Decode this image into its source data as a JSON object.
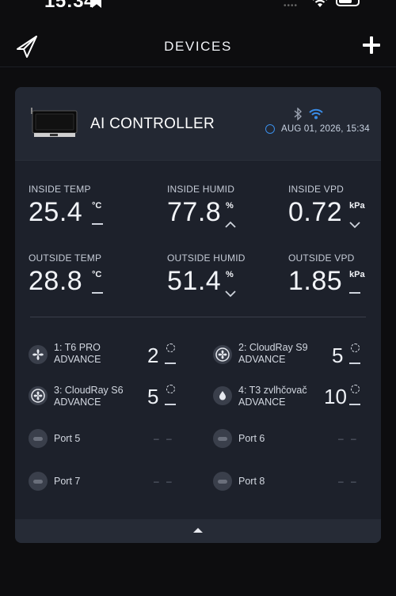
{
  "status_bar": {
    "time": "15:34"
  },
  "header": {
    "title": "DEVICES"
  },
  "device": {
    "name": "AI CONTROLLER",
    "timestamp": "AUG 01, 2026, 15:34"
  },
  "metrics": {
    "inside_temp": {
      "label": "INSIDE TEMP",
      "value": "25.4",
      "unit": "°C",
      "trend": "flat"
    },
    "inside_humid": {
      "label": "INSIDE HUMID",
      "value": "77.8",
      "unit": "%",
      "trend": "up"
    },
    "inside_vpd": {
      "label": "INSIDE VPD",
      "value": "0.72",
      "unit": "kPa",
      "trend": "down"
    },
    "outside_temp": {
      "label": "OUTSIDE TEMP",
      "value": "28.8",
      "unit": "°C",
      "trend": "flat"
    },
    "outside_humid": {
      "label": "OUTSIDE HUMID",
      "value": "51.4",
      "unit": "%",
      "trend": "down"
    },
    "outside_vpd": {
      "label": "OUTSIDE VPD",
      "value": "1.85",
      "unit": "kPa",
      "trend": "flat"
    }
  },
  "ports": [
    {
      "line1": "1: T6 PRO",
      "line2": "ADVANCE",
      "level": "2",
      "icon": "fan-icon"
    },
    {
      "line1": "2: CloudRay S9",
      "line2": "ADVANCE",
      "level": "5",
      "icon": "fan-icon"
    },
    {
      "line1": "3: CloudRay S6",
      "line2": "ADVANCE",
      "level": "5",
      "icon": "fan-icon"
    },
    {
      "line1": "4: T3 zvlhčovač",
      "line2": "ADVANCE",
      "level": "10",
      "icon": "water-drop-icon"
    },
    {
      "line1": "Port 5",
      "empty": "– –"
    },
    {
      "line1": "Port 6",
      "empty": "– –"
    },
    {
      "line1": "Port 7",
      "empty": "– –"
    },
    {
      "line1": "Port 8",
      "empty": "– –"
    }
  ],
  "colors": {
    "accent": "#3a8de8",
    "card": "#1d212b",
    "background": "#0d0d0f"
  }
}
